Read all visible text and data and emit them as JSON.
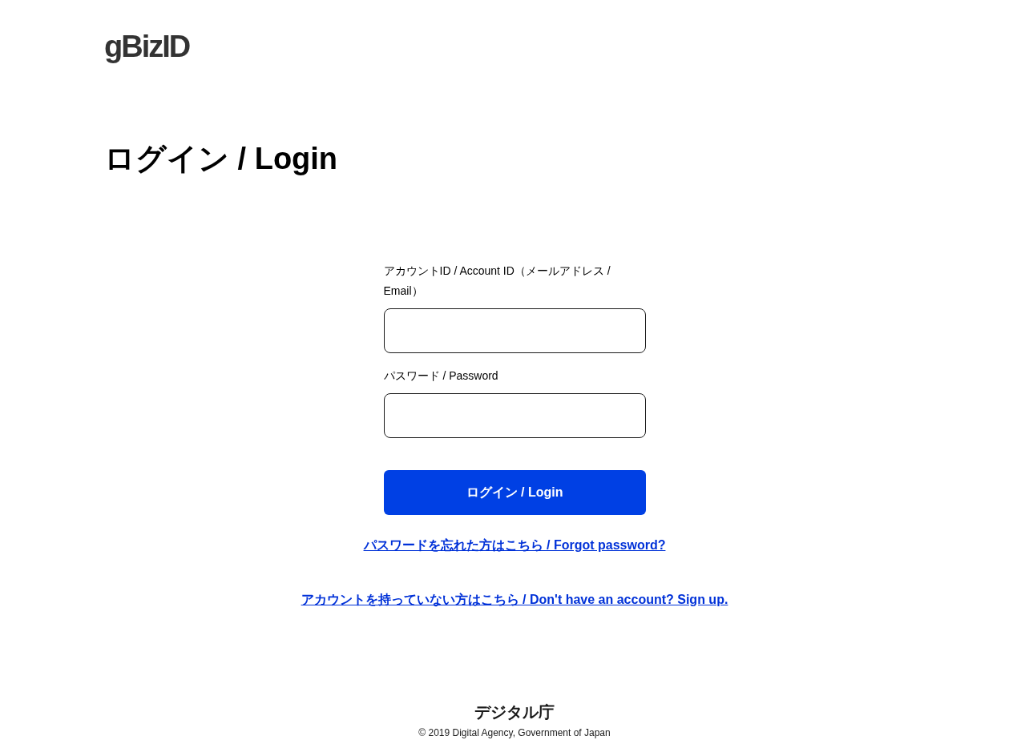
{
  "header": {
    "logo": "gBizID"
  },
  "title": "ログイン / Login",
  "form": {
    "fields": [
      {
        "label": "アカウントID / Account ID（メールアドレス / Email）"
      },
      {
        "label": "パスワード / Password"
      }
    ],
    "submit": "ログイン / Login"
  },
  "links": [
    "パスワードを忘れた方はこちら / Forgot password?",
    "アカウントを持っていない方はこちら / Don't have an account? Sign up."
  ],
  "footer": {
    "agency": "デジタル庁",
    "copyright": "© 2019 Digital Agency, Government of Japan"
  }
}
